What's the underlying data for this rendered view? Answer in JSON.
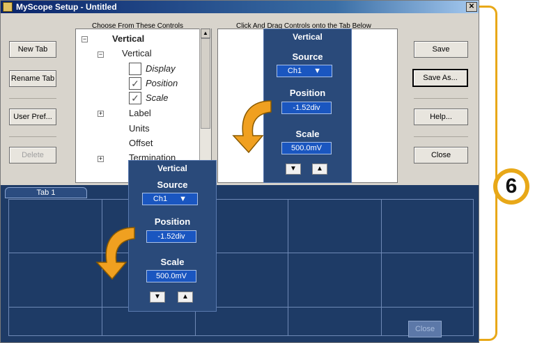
{
  "window": {
    "title": "MyScope Setup - Untitled",
    "close_glyph": "✕"
  },
  "left_buttons": {
    "new_tab": "New Tab",
    "rename_tab": "Rename Tab",
    "user_pref": "User Pref...",
    "delete": "Delete"
  },
  "right_buttons": {
    "save": "Save",
    "save_as": "Save As...",
    "help": "Help...",
    "close": "Close"
  },
  "headers": {
    "choose": "Choose From These Controls",
    "drag": "Click And Drag Controls onto the Tab Below"
  },
  "tree": {
    "root": "Vertical",
    "vertical": "Vertical",
    "display": "Display",
    "position": "Position",
    "scale": "Scale",
    "label": "Label",
    "units": "Units",
    "offset": "Offset",
    "termination": "Termination",
    "minus": "−",
    "plus": "+",
    "check": "✓"
  },
  "vertical_panel": {
    "title": "Vertical",
    "source_label": "Source",
    "source_value": "Ch1",
    "position_label": "Position",
    "position_value": "-1.52div",
    "scale_label": "Scale",
    "scale_value": "500.0mV",
    "down_glyph": "▼",
    "up_glyph": "▲"
  },
  "vertical_panel_lower": {
    "position_value": "-1.52div",
    "scale_value": "500.0mV"
  },
  "tabs": {
    "tab1": "Tab 1",
    "close": "Close"
  },
  "callout": {
    "number": "6"
  },
  "colors": {
    "accent": "#e8a818",
    "arrow": "#f0a020",
    "tab_area": "#1e3b66",
    "panel": "#2a4a7a"
  }
}
